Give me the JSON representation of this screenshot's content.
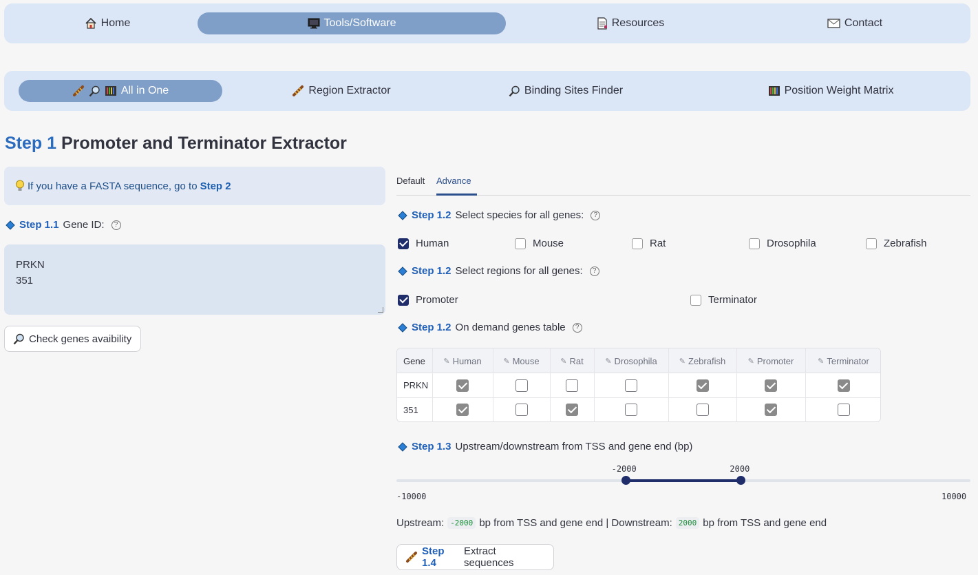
{
  "top_nav": [
    {
      "icon": "house-icon",
      "label": "Home"
    },
    {
      "icon": "monitor-icon",
      "label": "Tools/Software",
      "active": true
    },
    {
      "icon": "document-icon",
      "label": "Resources"
    },
    {
      "icon": "mail-icon",
      "label": "Contact"
    }
  ],
  "sub_nav": [
    {
      "label": "All in One",
      "active": true
    },
    {
      "label": "Region Extractor"
    },
    {
      "label": "Binding Sites Finder"
    },
    {
      "label": "Position Weight Matrix"
    }
  ],
  "title": {
    "step": "Step 1",
    "text": "Promoter and Terminator Extractor"
  },
  "info": {
    "text": "If you have a FASTA sequence, go to",
    "link": "Step 2"
  },
  "gene_id": {
    "step": "Step 1.1",
    "label": "Gene ID:",
    "lines": [
      "PRKN",
      "351"
    ]
  },
  "check_button": "Check genes avaibility",
  "tabs": [
    "Default",
    "Advance"
  ],
  "species": {
    "step": "Step 1.2",
    "label": "Select species for all genes:",
    "options": [
      {
        "label": "Human",
        "checked": true
      },
      {
        "label": "Mouse",
        "checked": false
      },
      {
        "label": "Rat",
        "checked": false
      },
      {
        "label": "Drosophila",
        "checked": false
      },
      {
        "label": "Zebrafish",
        "checked": false
      }
    ]
  },
  "regions": {
    "step": "Step 1.2",
    "label": "Select regions for all genes:",
    "options": [
      {
        "label": "Promoter",
        "checked": true
      },
      {
        "label": "Terminator",
        "checked": false
      }
    ]
  },
  "table_section": {
    "step": "Step 1.2",
    "label": "On demand genes table"
  },
  "table": {
    "columns": [
      "Gene",
      "Human",
      "Mouse",
      "Rat",
      "Drosophila",
      "Zebrafish",
      "Promoter",
      "Terminator"
    ],
    "rows": [
      {
        "gene": "PRKN",
        "values": [
          true,
          false,
          false,
          false,
          true,
          true,
          true
        ]
      },
      {
        "gene": "351",
        "values": [
          true,
          false,
          true,
          false,
          false,
          true,
          false
        ]
      }
    ]
  },
  "range": {
    "step": "Step 1.3",
    "label": "Upstream/downstream from TSS and gene end (bp)",
    "min": -10000,
    "max": 10000,
    "low": -2000,
    "high": 2000,
    "min_label": "-10000",
    "max_label": "10000",
    "low_label": "-2000",
    "high_label": "2000"
  },
  "summary": {
    "up_label": "Upstream:",
    "up_value": "-2000",
    "up_suffix": "bp from TSS and gene end | Downstream:",
    "down_value": "2000",
    "down_suffix": "bp from TSS and gene end"
  },
  "extract": {
    "step": "Step 1.4",
    "label": "Extract sequences"
  }
}
